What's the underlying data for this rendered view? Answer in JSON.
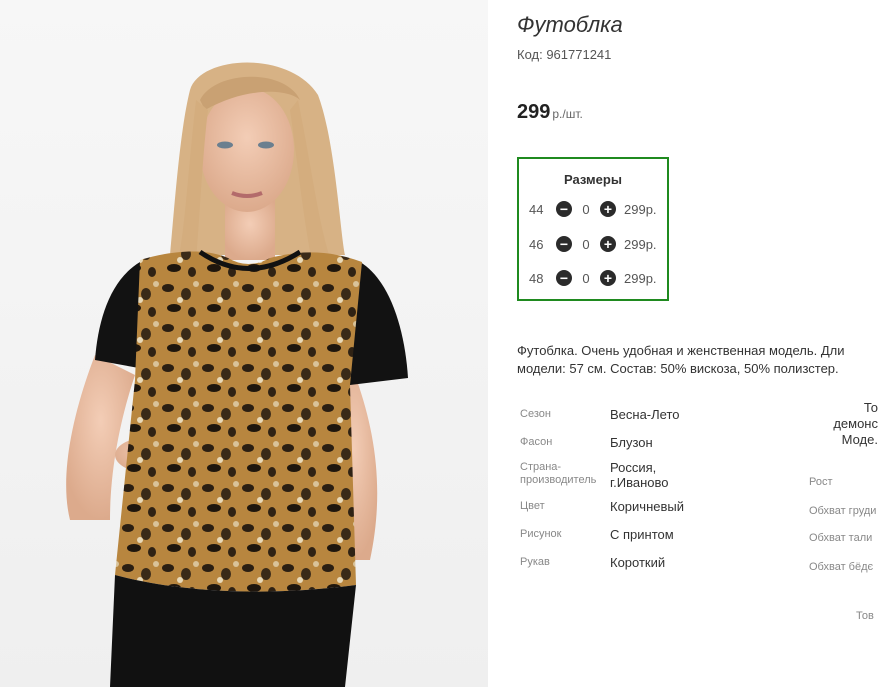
{
  "product": {
    "title": "Футоблка",
    "sku": "Код: 961771241",
    "price_value": "299",
    "price_unit": "р./шт."
  },
  "sizes": {
    "title": "Размеры",
    "rows": [
      {
        "size": "44",
        "qty": "0",
        "price": "299р."
      },
      {
        "size": "46",
        "qty": "0",
        "price": "299р."
      },
      {
        "size": "48",
        "qty": "0",
        "price": "299р."
      }
    ]
  },
  "description": {
    "line1": "Футоблка. Очень удобная и женственная модель. Дли",
    "line2": "модели: 57 см. Состав: 50% вискоза, 50% полизстер."
  },
  "attributes": [
    {
      "label": "Сезон",
      "value": "Весна-Лето"
    },
    {
      "label": "Фасон",
      "value": "Блузон"
    },
    {
      "label_l1": "Страна-",
      "label_l2": "производитель",
      "value_l1": "Россия,",
      "value_l2": "г.Иваново"
    },
    {
      "label": "Цвет",
      "value": "Коричневый"
    },
    {
      "label": "Рисунок",
      "value": "С принтом"
    },
    {
      "label": "Рукав",
      "value": "Короткий"
    }
  ],
  "model_panel": {
    "top_l1": "То",
    "top_l2": "демонс",
    "top_l3": "Моде.",
    "height": "Рост",
    "bust": "Обхват груди",
    "waist": "Обхват тали",
    "hips": "Обхват бёдє",
    "bottom": "Тов"
  },
  "colors": {
    "border_accent": "#1f8a1f",
    "button": "#2b2b2b"
  }
}
